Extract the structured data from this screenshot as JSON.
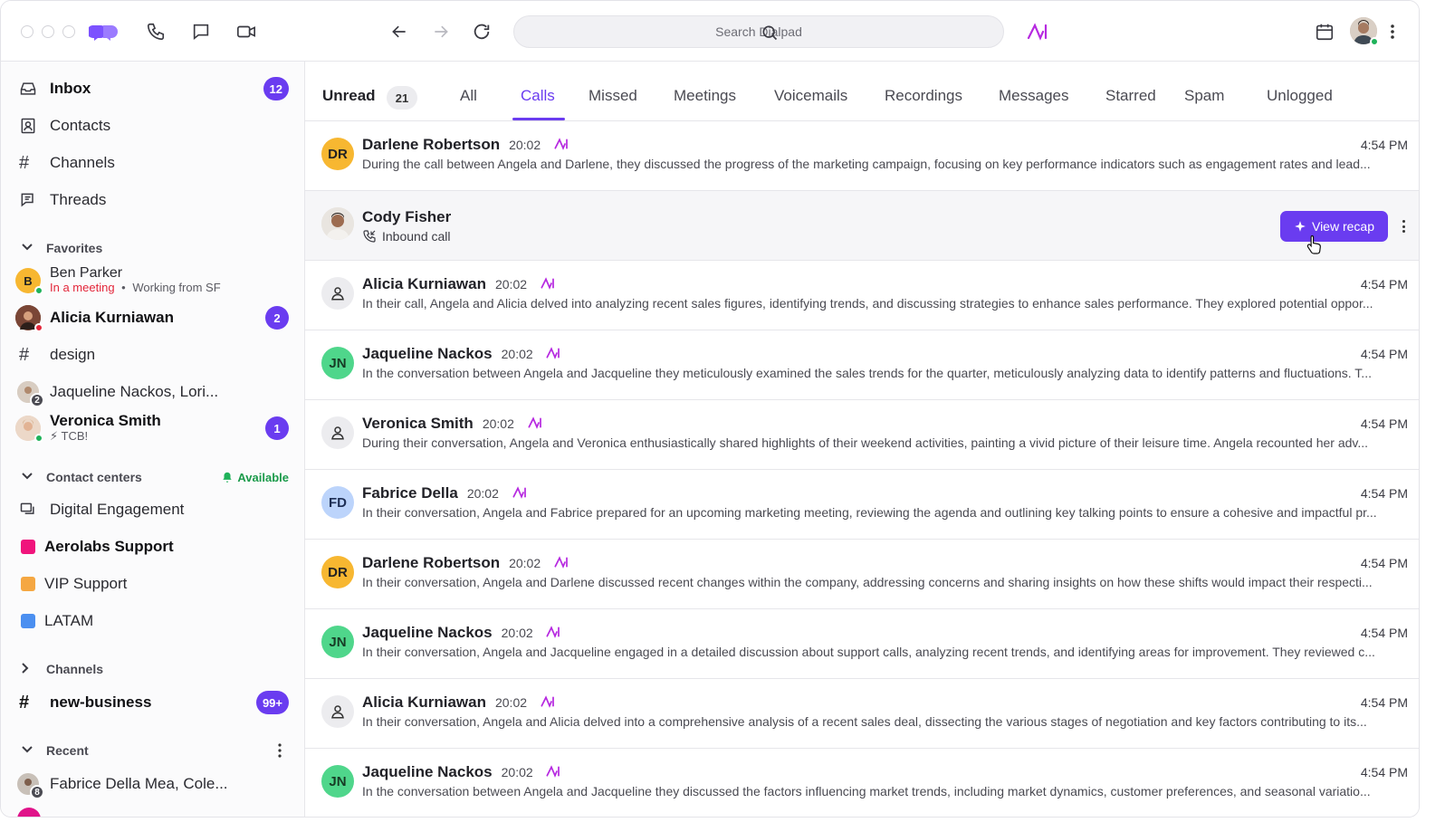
{
  "search": {
    "placeholder": "Search Dialpad"
  },
  "sidebar": {
    "inbox": {
      "label": "Inbox",
      "badge": "12"
    },
    "contacts": {
      "label": "Contacts"
    },
    "channels_nav": {
      "label": "Channels"
    },
    "threads": {
      "label": "Threads"
    },
    "favorites": {
      "header": "Favorites",
      "items": [
        {
          "name": "Ben Parker",
          "initial": "B",
          "status": "In a meeting",
          "sep": "•",
          "location": "Working from SF"
        },
        {
          "name": "Alicia Kurniawan",
          "badge": "2"
        },
        {
          "name": "design"
        },
        {
          "name": "Jaqueline Nackos, Lori...",
          "count": "2"
        },
        {
          "name": "Veronica Smith",
          "status": "⚡ TCB!",
          "badge": "1"
        }
      ]
    },
    "contact_centers": {
      "header": "Contact centers",
      "availability": "Available",
      "items": [
        {
          "name": "Digital Engagement"
        },
        {
          "name": "Aerolabs Support",
          "color": "#f0147c"
        },
        {
          "name": "VIP Support",
          "color": "#f5a742"
        },
        {
          "name": "LATAM",
          "color": "#4b8ff0"
        }
      ]
    },
    "channels": {
      "header": "Channels",
      "items": [
        {
          "name": "new-business",
          "badge": "99+"
        }
      ]
    },
    "recent": {
      "header": "Recent",
      "items": [
        {
          "name": "Fabrice Della Mea, Cole...",
          "count": "8"
        }
      ]
    }
  },
  "tabs": {
    "unread": "Unread",
    "unread_count": "21",
    "all": "All",
    "calls": "Calls",
    "missed": "Missed",
    "meetings": "Meetings",
    "voicemails": "Voicemails",
    "recordings": "Recordings",
    "messages": "Messages",
    "starred": "Starred",
    "spam": "Spam",
    "unlogged": "Unlogged"
  },
  "calls": [
    {
      "name": "Darlene Robertson",
      "initials": "DR",
      "duration": "20:02",
      "time": "4:54 PM",
      "summary": "During the call between Angela and Darlene, they discussed the progress of the marketing campaign, focusing on key performance indicators such as engagement rates and lead..."
    },
    {
      "name": "Cody Fisher",
      "subtitle": "Inbound call",
      "action": "View recap"
    },
    {
      "name": "Alicia Kurniawan",
      "duration": "20:02",
      "time": "4:54 PM",
      "summary": "In their call, Angela and Alicia delved into analyzing recent sales figures, identifying trends, and discussing strategies to enhance sales performance. They explored potential oppor..."
    },
    {
      "name": "Jaqueline Nackos",
      "initials": "JN",
      "duration": "20:02",
      "time": "4:54 PM",
      "summary": "In the conversation between Angela and Jacqueline they meticulously examined the sales trends for the quarter, meticulously analyzing data to identify patterns and fluctuations. T..."
    },
    {
      "name": "Veronica Smith",
      "duration": "20:02",
      "time": "4:54 PM",
      "summary": "During their conversation, Angela and Veronica enthusiastically shared highlights of their weekend activities, painting a vivid picture of their leisure time. Angela recounted her adv..."
    },
    {
      "name": "Fabrice Della",
      "initials": "FD",
      "duration": "20:02",
      "time": "4:54 PM",
      "summary": "In their conversation, Angela and Fabrice prepared for an upcoming marketing meeting, reviewing the agenda and outlining key talking points to ensure a cohesive and impactful pr..."
    },
    {
      "name": "Darlene Robertson",
      "initials": "DR",
      "duration": "20:02",
      "time": "4:54 PM",
      "summary": "In their conversation, Angela and Darlene discussed recent changes within the company, addressing concerns and sharing insights on how these shifts would impact their respecti..."
    },
    {
      "name": "Jaqueline Nackos",
      "initials": "JN",
      "duration": "20:02",
      "time": "4:54 PM",
      "summary": "In their conversation, Angela and Jacqueline engaged in a detailed discussion about support calls, analyzing recent trends, and identifying areas for improvement. They reviewed c..."
    },
    {
      "name": "Alicia Kurniawan",
      "duration": "20:02",
      "time": "4:54 PM",
      "summary": "In their conversation, Angela and Alicia delved into a comprehensive analysis of a recent sales deal, dissecting the various stages of negotiation and key factors contributing to its..."
    },
    {
      "name": "Jaqueline Nackos",
      "initials": "JN",
      "duration": "20:02",
      "time": "4:54 PM",
      "summary": "In the conversation between Angela and Jacqueline they discussed the factors influencing market trends, including market dynamics, customer preferences, and seasonal variatio..."
    }
  ],
  "colors": {
    "accent": "#6a3cf0",
    "dr_avatar": "#f7b731",
    "jn_avatar": "#4fd68b",
    "fd_avatar": "#bcd4fb",
    "online": "#1fb25a",
    "busy": "#e3263a"
  }
}
